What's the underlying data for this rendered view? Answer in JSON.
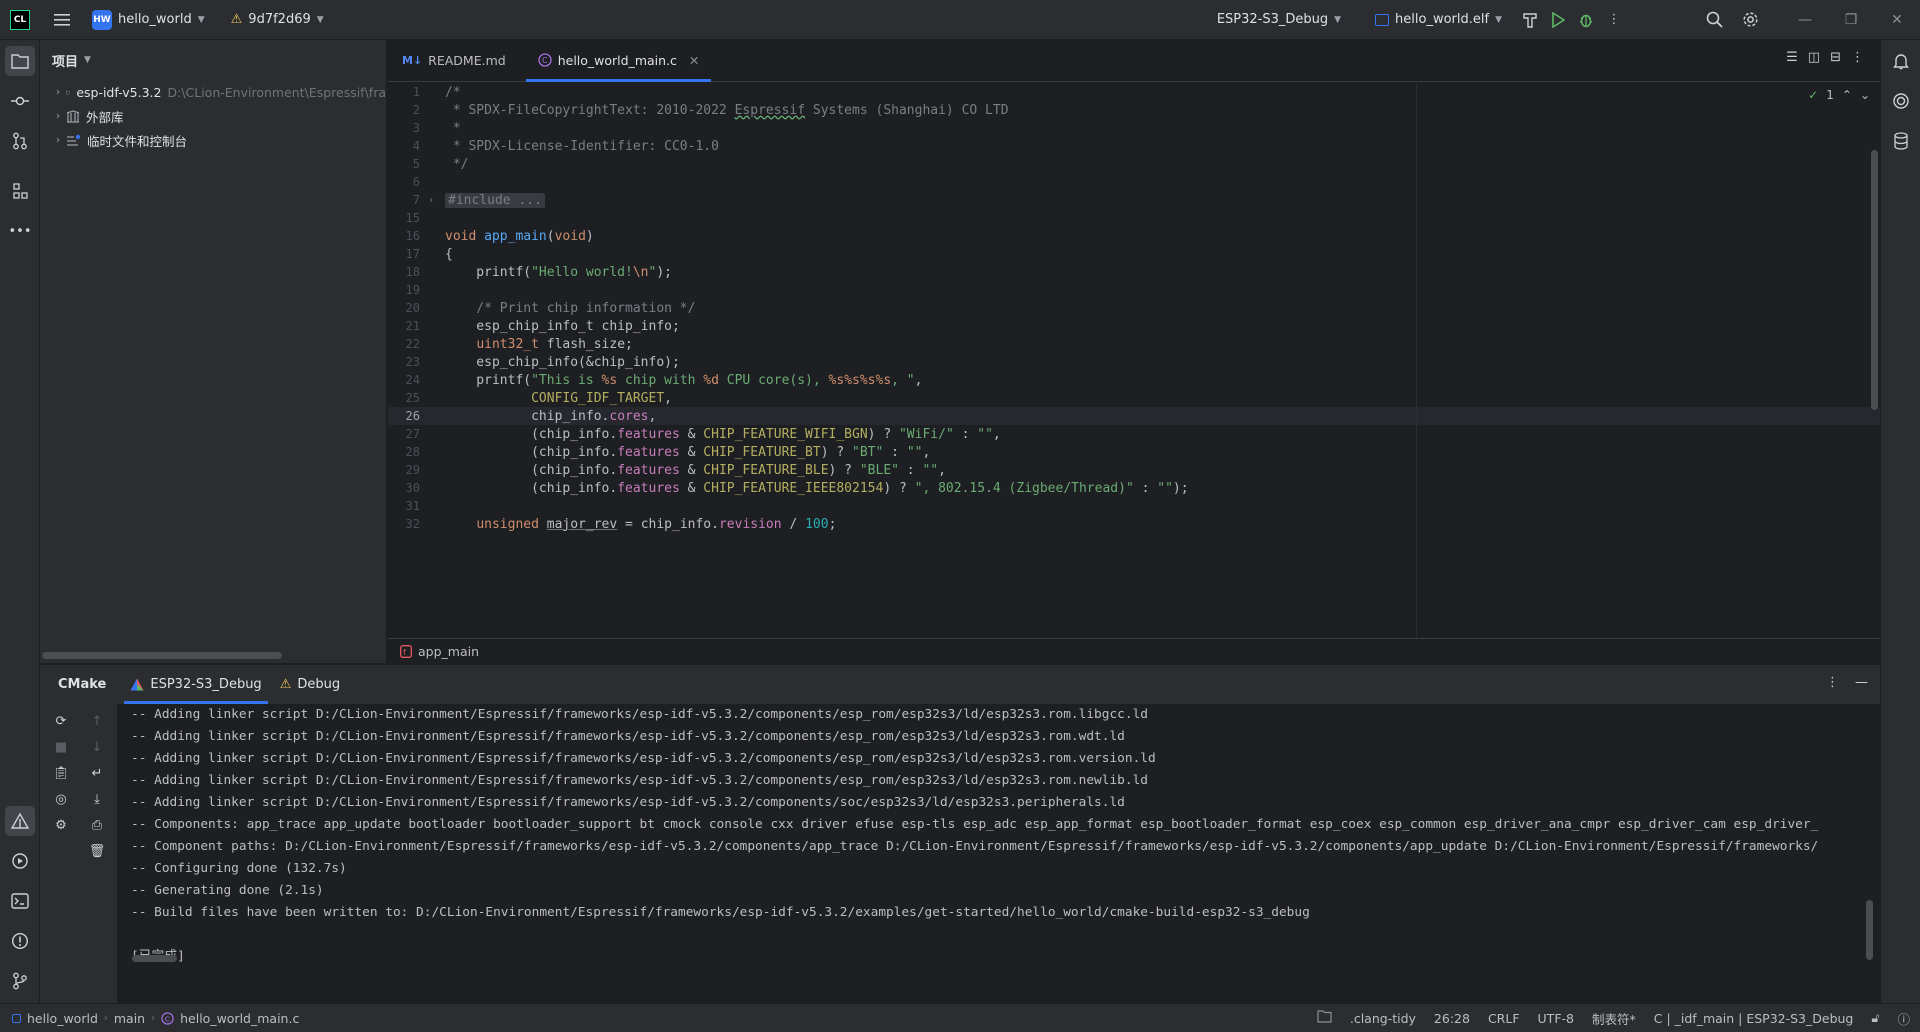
{
  "titlebar": {
    "project_badge": "HW",
    "project_name": "hello_world",
    "vcs_revision": "9d7f2d69",
    "run_config": "ESP32-S3_Debug",
    "target": "hello_world.elf"
  },
  "project_panel": {
    "title": "项目",
    "items": [
      {
        "label": "esp-idf-v5.3.2",
        "path": "D:\\CLion-Environment\\Espressif\\fra"
      },
      {
        "label": "外部库",
        "path": ""
      },
      {
        "label": "临时文件和控制台",
        "path": ""
      }
    ]
  },
  "editor": {
    "tabs": [
      {
        "label": "README.md",
        "icon": "markdown-icon"
      },
      {
        "label": "hello_world_main.c",
        "icon": "c-file-icon"
      }
    ],
    "inspection_count": "1",
    "current_line": "26",
    "breadcrumb": "app_main",
    "lines": [
      {
        "n": "1",
        "text": "/*"
      },
      {
        "n": "2",
        "text": " * SPDX-FileCopyrightText: 2010-2022 Espressif Systems (Shanghai) CO LTD"
      },
      {
        "n": "3",
        "text": " *"
      },
      {
        "n": "4",
        "text": " * SPDX-License-Identifier: CC0-1.0"
      },
      {
        "n": "5",
        "text": " */"
      },
      {
        "n": "6",
        "text": ""
      },
      {
        "n": "7",
        "text": "#include ..."
      },
      {
        "n": "15",
        "text": ""
      },
      {
        "n": "16",
        "text": "void app_main(void)"
      },
      {
        "n": "17",
        "text": "{"
      },
      {
        "n": "18",
        "text": "    printf(\"Hello world!\\n\");"
      },
      {
        "n": "19",
        "text": ""
      },
      {
        "n": "20",
        "text": "    /* Print chip information */"
      },
      {
        "n": "21",
        "text": "    esp_chip_info_t chip_info;"
      },
      {
        "n": "22",
        "text": "    uint32_t flash_size;"
      },
      {
        "n": "23",
        "text": "    esp_chip_info(&chip_info);"
      },
      {
        "n": "24",
        "text": "    printf(\"This is %s chip with %d CPU core(s), %s%s%s%s, \","
      },
      {
        "n": "25",
        "text": "           CONFIG_IDF_TARGET,"
      },
      {
        "n": "26",
        "text": "           chip_info.cores,"
      },
      {
        "n": "27",
        "text": "           (chip_info.features & CHIP_FEATURE_WIFI_BGN) ? \"WiFi/\" : \"\","
      },
      {
        "n": "28",
        "text": "           (chip_info.features & CHIP_FEATURE_BT) ? \"BT\" : \"\","
      },
      {
        "n": "29",
        "text": "           (chip_info.features & CHIP_FEATURE_BLE) ? \"BLE\" : \"\","
      },
      {
        "n": "30",
        "text": "           (chip_info.features & CHIP_FEATURE_IEEE802154) ? \", 802.15.4 (Zigbee/Thread)\" : \"\");"
      },
      {
        "n": "31",
        "text": ""
      },
      {
        "n": "32",
        "text": "    unsigned major_rev = chip_info.revision / 100;"
      }
    ]
  },
  "bottom_panel": {
    "title": "CMake",
    "tabs": [
      {
        "label": "ESP32-S3_Debug"
      },
      {
        "label": "Debug"
      }
    ],
    "console_lines": [
      "-- Adding linker script D:/CLion-Environment/Espressif/frameworks/esp-idf-v5.3.2/components/esp_rom/esp32s3/ld/esp32s3.rom.libgcc.ld",
      "-- Adding linker script D:/CLion-Environment/Espressif/frameworks/esp-idf-v5.3.2/components/esp_rom/esp32s3/ld/esp32s3.rom.wdt.ld",
      "-- Adding linker script D:/CLion-Environment/Espressif/frameworks/esp-idf-v5.3.2/components/esp_rom/esp32s3/ld/esp32s3.rom.version.ld",
      "-- Adding linker script D:/CLion-Environment/Espressif/frameworks/esp-idf-v5.3.2/components/esp_rom/esp32s3/ld/esp32s3.rom.newlib.ld",
      "-- Adding linker script D:/CLion-Environment/Espressif/frameworks/esp-idf-v5.3.2/components/soc/esp32s3/ld/esp32s3.peripherals.ld",
      "-- Components: app_trace app_update bootloader bootloader_support bt cmock console cxx driver efuse esp-tls esp_adc esp_app_format esp_bootloader_format esp_coex esp_common esp_driver_ana_cmpr esp_driver_cam esp_driver_",
      "-- Component paths: D:/CLion-Environment/Espressif/frameworks/esp-idf-v5.3.2/components/app_trace D:/CLion-Environment/Espressif/frameworks/esp-idf-v5.3.2/components/app_update D:/CLion-Environment/Espressif/frameworks/",
      "-- Configuring done (132.7s)",
      "-- Generating done (2.1s)",
      "-- Build files have been written to: D:/CLion-Environment/Espressif/frameworks/esp-idf-v5.3.2/examples/get-started/hello_world/cmake-build-esp32-s3_debug",
      "",
      "[已完成]"
    ]
  },
  "statusbar": {
    "breadcrumb": [
      "hello_world",
      "main",
      "hello_world_main.c"
    ],
    "clang_tidy": ".clang-tidy",
    "position": "26:28",
    "line_ending": "CRLF",
    "encoding": "UTF-8",
    "indent": "制表符*",
    "context": "C | _idf_main | ESP32-S3_Debug"
  }
}
